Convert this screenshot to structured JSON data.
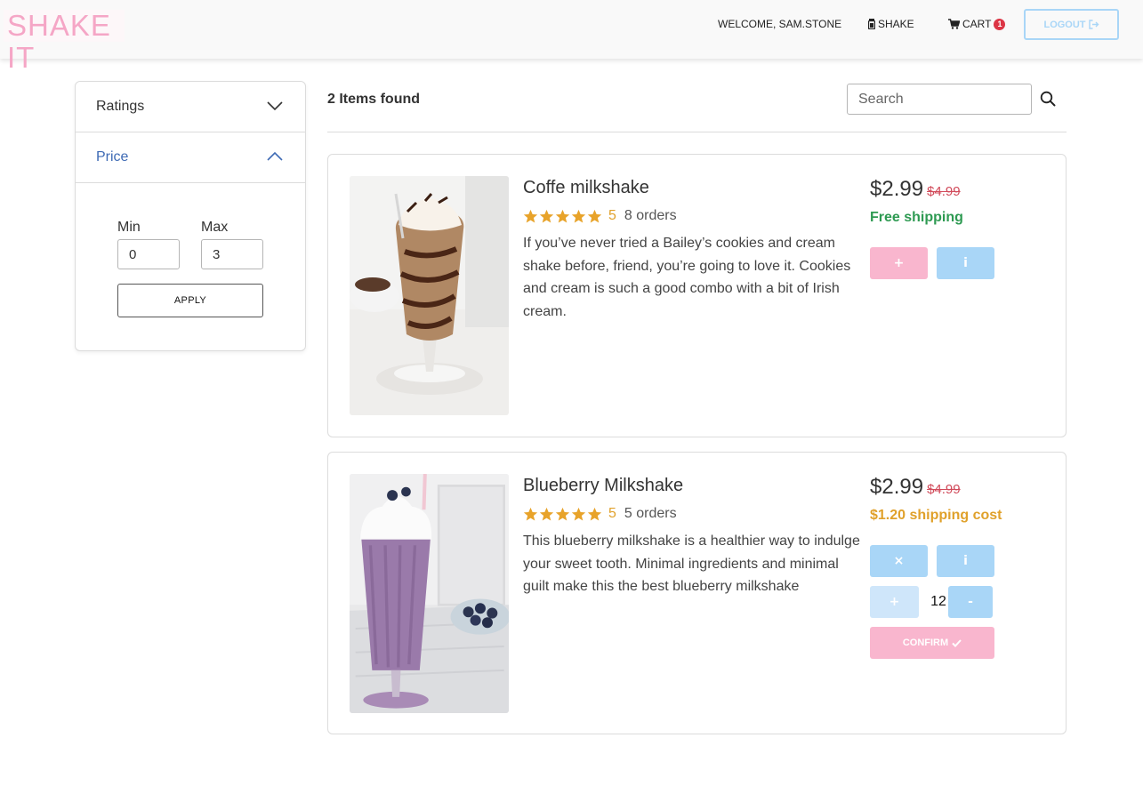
{
  "brand": {
    "logo_text": "SHAKE IT"
  },
  "nav": {
    "welcome": "WELCOME, SAM.STONE",
    "shake": "SHAKE",
    "cart": "CART",
    "cart_count": "1",
    "logout": "LOGOUT"
  },
  "filters": {
    "ratings_label": "Ratings",
    "price_label": "Price",
    "min_label": "Min",
    "max_label": "Max",
    "min_value": "0",
    "max_value": "3",
    "apply_label": "APPLY"
  },
  "results": {
    "count_text": "2 Items found",
    "search_placeholder": "Search"
  },
  "products": [
    {
      "name": "Coffe milkshake",
      "rating": "5",
      "orders": "8 orders",
      "description": "If you’ve never tried a Bailey’s cookies and cream shake before, friend, you’re going to love it. Cookies and cream is such a good combo with a bit of Irish cream.",
      "price": "$2.99",
      "old_price": "$4.99",
      "shipping": "Free shipping",
      "add_label": "+",
      "info_label": "i"
    },
    {
      "name": "Blueberry Milkshake",
      "rating": "5",
      "orders": "5 orders",
      "description": "This blueberry milkshake is a healthier way to indulge your sweet tooth. Minimal ingredients and minimal guilt make this the best blueberry milkshake",
      "price": "$2.99",
      "old_price": "$4.99",
      "shipping": "$1.20 shipping cost",
      "remove_label": "×",
      "info_label": "i",
      "inc_label": "+",
      "quantity": "12",
      "dec_label": "-",
      "confirm_label": "CONFIRM"
    }
  ],
  "colors": {
    "accent_pink": "#f9b6ce",
    "accent_blue": "#a9d6f7",
    "star": "#e8a32a",
    "free_shipping": "#2e9a52",
    "shipping_cost": "#e0a12b",
    "old_price": "#d14a5a"
  }
}
